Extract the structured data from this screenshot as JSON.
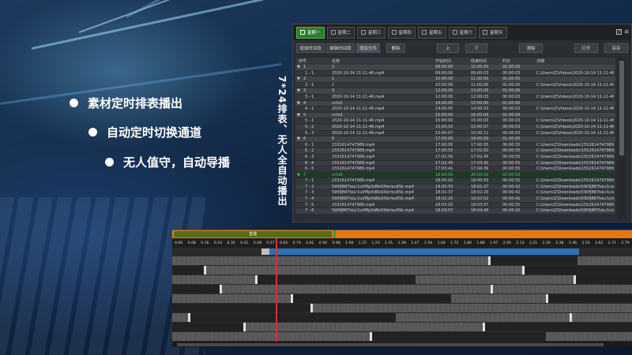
{
  "bullets": [
    {
      "text": "素材定时排表播出"
    },
    {
      "text": "自动定时切换通道"
    },
    {
      "text": "无人值守，自动导播"
    }
  ],
  "vertical_caption": "7*24排表、无人全自动播出",
  "day_tabs": [
    {
      "label": "星期一",
      "active": true
    },
    {
      "label": "星期二",
      "active": false
    },
    {
      "label": "星期三",
      "active": false
    },
    {
      "label": "星期四",
      "active": false
    },
    {
      "label": "星期五",
      "active": false
    },
    {
      "label": "星期六",
      "active": false
    },
    {
      "label": "星期天",
      "active": false
    }
  ],
  "auto_checkbox": {
    "label": "启",
    "checked": true
  },
  "toolbar": {
    "add_time": "增加时间段",
    "edit_time": "编辑时间段",
    "add_file": "增加文件",
    "delete": "删除",
    "up": "上",
    "down": "下",
    "clear": "清除",
    "open": "打开",
    "save_as": "另存"
  },
  "table_headers": {
    "seq": "序号",
    "name": "名称",
    "start": "开始时间",
    "end": "结束时间",
    "duration": "时长",
    "detail": "详细"
  },
  "table_rows": [
    {
      "seq": "1",
      "name": "2",
      "start": "09:00:00",
      "end": "10:00:00",
      "duration": "01:00:00",
      "detail": "",
      "type": "parent",
      "expand": "▼"
    },
    {
      "seq": "1 - 1",
      "name": "2020-10-14 11-11-46.mp4",
      "start": "09:00:00",
      "end": "09:00:03",
      "duration": "00:00:03",
      "detail": "C:\\Users\\Z\\Videos\\2020-10-14 11-11-46.mp4",
      "type": "child"
    },
    {
      "seq": "2",
      "name": "1",
      "start": "10:00:00",
      "end": "11:00:00",
      "duration": "01:00:00",
      "detail": "",
      "type": "parent",
      "expand": "▼"
    },
    {
      "seq": "2 - 1",
      "name": "1",
      "start": "10:00:00",
      "end": "11:00:00",
      "duration": "01:00:00",
      "detail": "C:\\Users\\Z\\Videos\\2020-10-14 11-11-46.mp4",
      "type": "child"
    },
    {
      "seq": "3",
      "name": "3",
      "start": "12:00:00",
      "end": "13:00:00",
      "duration": "01:00:00",
      "detail": "",
      "type": "parent",
      "expand": "▼"
    },
    {
      "seq": "3 - 1",
      "name": "2020-10-14 11-11-46.mp4",
      "start": "12:00:00",
      "end": "12:00:03",
      "duration": "00:00:03",
      "detail": "C:\\Users\\Z\\Videos\\2020-10-14 11-11-46.mp4",
      "type": "child"
    },
    {
      "seq": "4",
      "name": "cctv1",
      "start": "14:00:00",
      "end": "15:00:00",
      "duration": "01:00:00",
      "detail": "",
      "type": "parent",
      "expand": "▼"
    },
    {
      "seq": "4 - 1",
      "name": "2020-10-14 11-11-46.mp4",
      "start": "14:00:00",
      "end": "14:00:03",
      "duration": "00:00:03",
      "detail": "C:\\Users\\Z\\Videos\\2020-10-14 11-11-46.mp4",
      "type": "child"
    },
    {
      "seq": "5",
      "name": "cctv2",
      "start": "15:00:00",
      "end": "16:00:00",
      "duration": "01:00:00",
      "detail": "",
      "type": "parent",
      "expand": "▼"
    },
    {
      "seq": "5 - 1",
      "name": "2020-10-14 11-11-46.mp4",
      "start": "15:00:00",
      "end": "15:00:03",
      "duration": "00:00:03",
      "detail": "C:\\Users\\Z\\Videos\\2020-10-14 11-11-46.mp4",
      "type": "child"
    },
    {
      "seq": "5 - 2",
      "name": "2020-10-14 11-11-46.mp4",
      "start": "15:00:03",
      "end": "15:00:07",
      "duration": "00:00:03",
      "detail": "C:\\Users\\Z\\Videos\\2020-10-14 11-11-46.mp4",
      "type": "child"
    },
    {
      "seq": "5 - 3",
      "name": "2020-10-14 11-11-46.mp4",
      "start": "15:00:07",
      "end": "15:00:11",
      "duration": "00:00:03",
      "detail": "C:\\Users\\Z\\Videos\\2020-10-14 11-11-46.mp4",
      "type": "child"
    },
    {
      "seq": "6",
      "name": "6",
      "start": "17:00:00",
      "end": "18:00:00",
      "duration": "01:00:00",
      "detail": "",
      "type": "parent",
      "expand": "▼"
    },
    {
      "seq": "6 - 1",
      "name": "155261474798​9.mp4",
      "start": "17:00:00",
      "end": "17:00:55",
      "duration": "00:00:55",
      "detail": "C:\\Users\\Z\\Downloads\\155261474798​9.mp4",
      "type": "child"
    },
    {
      "seq": "6 - 2",
      "name": "155261474798​9.mp4",
      "start": "17:00:55",
      "end": "17:01:50",
      "duration": "00:00:55",
      "detail": "C:\\Users\\Z\\Downloads\\155261474798​9.mp4",
      "type": "child"
    },
    {
      "seq": "6 - 3",
      "name": "155261474798​9.mp4",
      "start": "17:01:50",
      "end": "17:02:45",
      "duration": "00:00:55",
      "detail": "C:\\Users\\Z\\Downloads\\155261474798​9.mp4",
      "type": "child"
    },
    {
      "seq": "6 - 4",
      "name": "155261474798​9.mp4",
      "start": "17:02:45",
      "end": "17:03:41",
      "duration": "00:00:55",
      "detail": "C:\\Users\\Z\\Downloads\\155261474798​9.mp4",
      "type": "child"
    },
    {
      "seq": "6 - 5",
      "name": "155261474798​9.mp4",
      "start": "17:03:41",
      "end": "17:04:36",
      "duration": "00:00:55",
      "detail": "C:\\Users\\Z\\Downloads\\155261474798​9.mp4",
      "type": "child"
    },
    {
      "seq": "7",
      "name": "cctv6",
      "start": "18:00:00",
      "end": "20:00:00",
      "duration": "02:00:00",
      "detail": "",
      "type": "selected",
      "expand": "▼"
    },
    {
      "seq": "7 - 1",
      "name": "155261474798​9.mp4",
      "start": "18:00:00",
      "end": "18:00:55",
      "duration": "00:00:55",
      "detail": "C:\\Users\\Z\\Downloads\\155261474798​9.mp4",
      "type": "child"
    },
    {
      "seq": "7 - 2",
      "name": "590fJ887teLr1uVMpXdRo0Xbrlou65k.mp4",
      "start": "18:00:55",
      "end": "18:01:37",
      "duration": "00:00:42",
      "detail": "C:\\Users\\Z\\Downloads\\590fJ887teLr1uVMpX",
      "type": "child"
    },
    {
      "seq": "7 - 3",
      "name": "590fJ887teLr1uVMpXdRo0Xbrlou65k.mp4",
      "start": "18:01:37",
      "end": "18:02:20",
      "duration": "00:00:42",
      "detail": "C:\\Users\\Z\\Downloads\\590fJ887teLr1uVMpX",
      "type": "child"
    },
    {
      "seq": "7 - 4",
      "name": "590fJ887teLr1uVMpXdRo0Xbrlou65k.mp4",
      "start": "18:02:20",
      "end": "18:03:02",
      "duration": "00:00:42",
      "detail": "C:\\Users\\Z\\Downloads\\590fJ887teLr1uVMpX",
      "type": "child"
    },
    {
      "seq": "7 - 5",
      "name": "155261474798​9.mp4",
      "start": "18:03:02",
      "end": "18:03:57",
      "duration": "00:00:55",
      "detail": "C:\\Users\\Z\\Downloads\\155261474798​9.mp4",
      "type": "child"
    },
    {
      "seq": "7 - 6",
      "name": "590fJ887teLr1uVMpXdRo0Xbrlou65k.mp4",
      "start": "18:03:57",
      "end": "18:04:40",
      "duration": "00:00:42",
      "detail": "C:\\Users\\Z\\Downloads\\590fJ887teLr1uVMpX",
      "type": "child"
    }
  ],
  "timeline": {
    "segment_label": "直播",
    "ruler_ticks": [
      "0.00",
      "0.08",
      "0.16",
      "0.24",
      "0.32",
      "0.41",
      "0.49",
      "0.57",
      "0.65",
      "0.74",
      "0.82",
      "0.90",
      "0.98",
      "1.06",
      "1.15",
      "1.23",
      "1.31",
      "1.39",
      "1.47",
      "1.56",
      "1.64",
      "1.72",
      "1.80",
      "1.88",
      "1.97",
      "2.05",
      "2.13",
      "2.21",
      "2.30",
      "2.38",
      "2.46",
      "2.54",
      "2.62",
      "2.71",
      "2.79"
    ]
  },
  "colors": {
    "active_tab": "#2e7d32",
    "selected_row_text": "#48d05a",
    "timeline_top": "#e07b10",
    "timeline_clip": "#2d6fb8",
    "playhead": "#d9302b"
  }
}
